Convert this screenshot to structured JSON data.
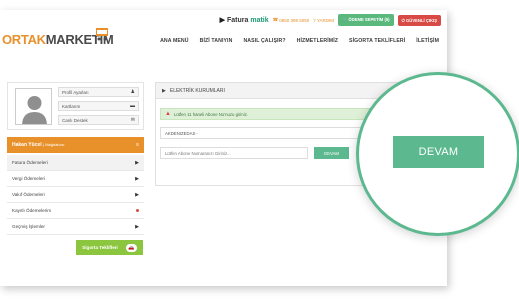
{
  "brand": {
    "logo_part1": "ORTAK",
    "logo_part2": "MARKETİM",
    "logo_badge": "cart-icon",
    "colors": {
      "orange": "#e8912b",
      "green": "#5cb88f",
      "red": "#d84b45",
      "lime": "#8cc63f"
    }
  },
  "topbar": {
    "faturamatik_a": "Fatura",
    "faturamatik_b": "matik",
    "phone": "0850 399 5050",
    "help": "YARDIM",
    "payment_button": "ÖDEME SEPETİM (5)",
    "logout_button": "GÜVENLİ ÇIKIŞ"
  },
  "nav": {
    "items": [
      "ANA MENÜ",
      "BİZİ TANIYIN",
      "NASIL ÇALIŞIR?",
      "HİZMETLERİMİZ",
      "SİGORTA TEKLİFLERİ",
      "İLETİŞİM"
    ]
  },
  "profile": {
    "menu": [
      {
        "label": "Profil Ayarları",
        "icon": "user-icon"
      },
      {
        "label": "Kartlarım",
        "icon": "card-icon"
      },
      {
        "label": "Canlı Destek",
        "icon": "chat-icon"
      }
    ],
    "user_name": "Hakan Yücel",
    "user_role": "| Mağdalcısı"
  },
  "sidebar": {
    "items": [
      {
        "label": "Fatura Ödemeleri",
        "active": true
      },
      {
        "label": "Vergi Ödemeleri"
      },
      {
        "label": "Vakıf Ödemeleri"
      },
      {
        "label": "Kayıtlı Ödemelerim",
        "dot": true
      },
      {
        "label": "Geçmiş İşlemler"
      }
    ],
    "insurance_button": "Sigorta Teklifleri"
  },
  "panel": {
    "title": "ELEKTRİK KURUMLARI",
    "alert": "Lütfen 11 haneli Abone No'nuzu giriniz.",
    "select_value": "AKDENIZEDAS -",
    "input_placeholder": "Lütfen Abone Numaranızı Giriniz...",
    "submit_label": "DEVAM"
  },
  "zoom": {
    "button_label": "DEVAM"
  }
}
